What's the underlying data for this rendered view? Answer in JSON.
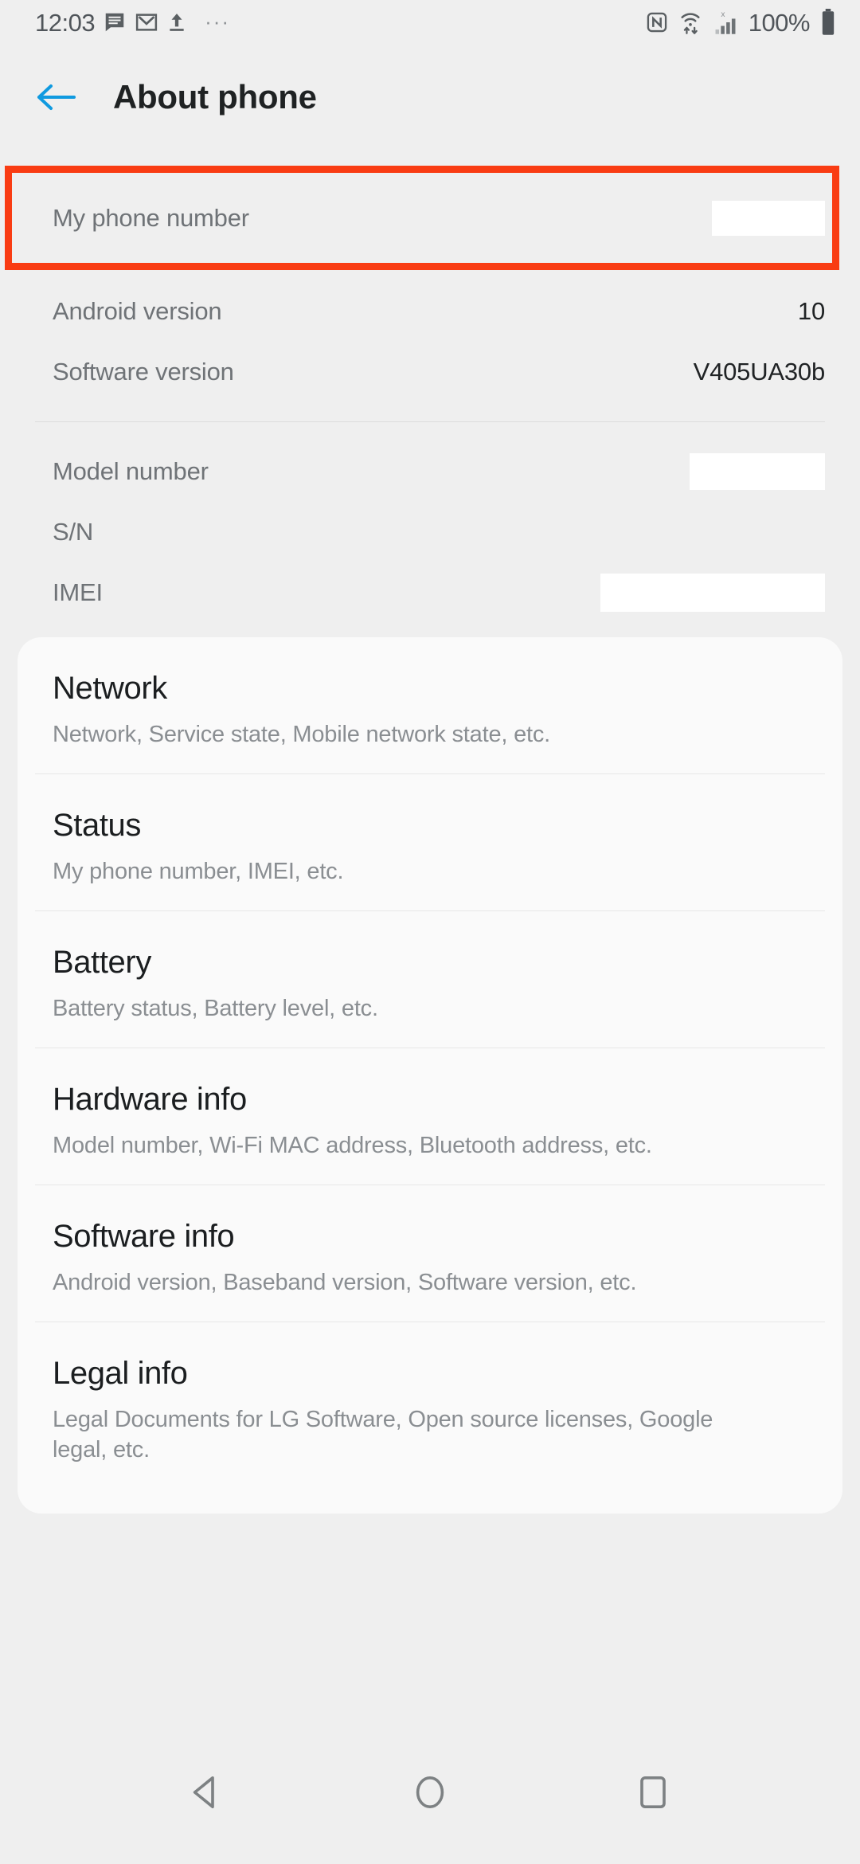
{
  "statusbar": {
    "time": "12:03",
    "battery_percent": "100%",
    "overflow_dots": "···",
    "icons": {
      "messages": "messages-icon",
      "gmail": "gmail-icon",
      "upload": "upload-icon",
      "nfc": "nfc-icon",
      "wifi": "wifi-no-internet-icon",
      "signal": "cellular-signal-icon",
      "battery": "battery-full-icon"
    }
  },
  "header": {
    "title": "About phone",
    "back_icon": "back-arrow-icon"
  },
  "annotation": {
    "color": "#f93c13"
  },
  "info_rows": [
    {
      "label": "My phone number",
      "value": "",
      "redacted": true,
      "redact_w": 142,
      "redact_h": 44
    },
    {
      "label": "Android version",
      "value": "10",
      "redacted": false
    },
    {
      "label": "Software version",
      "value": "V405UA30b",
      "redacted": false
    },
    {
      "label": "Model number",
      "value": "",
      "redacted": true,
      "redact_w": 170,
      "redact_h": 46
    },
    {
      "label": "S/N",
      "value": "",
      "redacted": false
    },
    {
      "label": "IMEI",
      "value": "",
      "redacted": true,
      "redact_w": 282,
      "redact_h": 48
    }
  ],
  "card_items": [
    {
      "title": "Network",
      "subtitle": "Network, Service state, Mobile network state, etc."
    },
    {
      "title": "Status",
      "subtitle": "My phone number, IMEI, etc."
    },
    {
      "title": "Battery",
      "subtitle": "Battery status, Battery level, etc."
    },
    {
      "title": "Hardware info",
      "subtitle": "Model number, Wi-Fi MAC address, Bluetooth address, etc."
    },
    {
      "title": "Software info",
      "subtitle": "Android version, Baseband version, Software version, etc."
    },
    {
      "title": "Legal info",
      "subtitle": "Legal Documents for LG Software, Open source licenses, Google legal, etc."
    }
  ],
  "navbar": {
    "back": "nav-back-icon",
    "home": "nav-home-icon",
    "recents": "nav-recents-icon"
  }
}
